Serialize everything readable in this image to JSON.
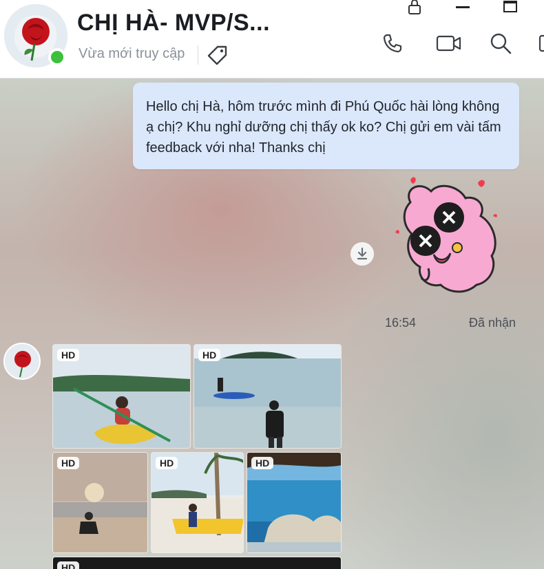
{
  "header": {
    "title": "CHỊ HÀ- MVP/S...",
    "status": "Vừa mới truy cập",
    "icons": [
      "lock-icon",
      "minimize-icon",
      "maximize-icon",
      "tag-icon",
      "phone-icon",
      "video-icon",
      "search-icon"
    ]
  },
  "messages": {
    "outgoing_text": "Hello chị Hà, hôm trước mình đi Phú Quốc hài lòng không ạ chị? Khu nghỉ dưỡng chị thấy ok ko? Chị gửi em vài tấm feedback với nha! Thanks chị",
    "time": "16:54",
    "receipt": "Đã nhận"
  },
  "photos": {
    "hd_label": "HD"
  },
  "colors": {
    "bubble": "#dbe7fb",
    "online": "#3bc13b",
    "sticker_pink": "#f7a9d2",
    "heart": "#f23b4c"
  }
}
